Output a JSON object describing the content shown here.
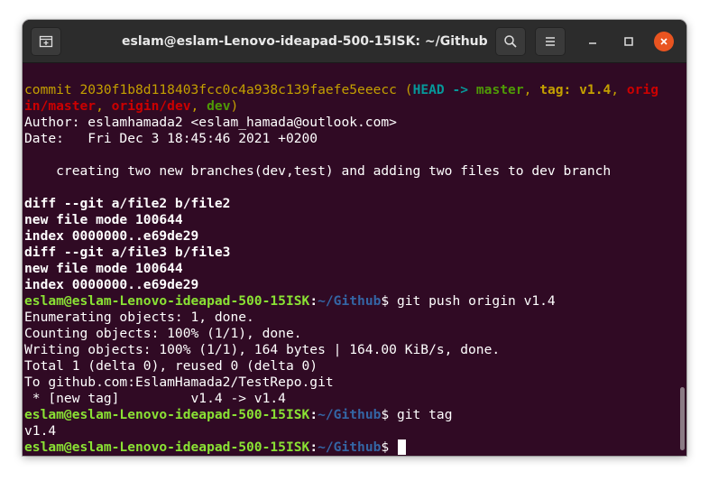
{
  "window": {
    "title": "eslam@eslam-Lenovo-ideapad-500-15ISK: ~/Github",
    "buttons": {
      "new_tab_icon": "new-tab-icon",
      "search_icon": "search-icon",
      "menu_icon": "hamburger-menu-icon",
      "minimize_icon": "minimize-icon",
      "maximize_icon": "maximize-icon",
      "close_icon": "close-icon"
    }
  },
  "colors": {
    "terminal_bg": "#300a24",
    "titlebar_bg": "#2c2c2c",
    "close_accent": "#e95420",
    "prompt_user": "#4e9a06",
    "prompt_path": "#3465a4",
    "commit_yellow": "#c4a000",
    "head_cyan": "#06989a",
    "branch_green": "#4e9a06",
    "remote_red": "#cc0000"
  },
  "terminal": {
    "commit_line1": {
      "commit_word": "commit",
      "hash": "2030f1b8d118403fcc0c4a938c139faefe5eeecc",
      "paren_open": "(",
      "head": "HEAD",
      "arrow": "->",
      "master": "master",
      "comma1": ",",
      "tag": "tag: v1.4",
      "comma2": ",",
      "orig_part": "orig"
    },
    "commit_line2": {
      "in_master": "in/master",
      "comma3": ",",
      "origin_dev": "origin/dev",
      "comma4": ",",
      "dev": "dev",
      "paren_close": ")"
    },
    "author_line": "Author: eslamhamada2 <eslam_hamada@outlook.com>",
    "date_line": "Date:   Fri Dec 3 18:45:46 2021 +0200",
    "message_line": "    creating two new branches(dev,test) and adding two files to dev branch",
    "diff_lines": [
      "diff --git a/file2 b/file2",
      "new file mode 100644",
      "index 0000000..e69de29",
      "diff --git a/file3 b/file3",
      "new file mode 100644",
      "index 0000000..e69de29"
    ],
    "prompt": {
      "user_host": "eslam@eslam-Lenovo-ideapad-500-15ISK",
      "colon": ":",
      "path": "~/Github",
      "dollar": "$"
    },
    "cmd_push": " git push origin v1.4",
    "push_output": [
      "Enumerating objects: 1, done.",
      "Counting objects: 100% (1/1), done.",
      "Writing objects: 100% (1/1), 164 bytes | 164.00 KiB/s, done.",
      "Total 1 (delta 0), reused 0 (delta 0)",
      "To github.com:EslamHamada2/TestRepo.git",
      " * [new tag]         v1.4 -> v1.4"
    ],
    "cmd_tag": " git tag",
    "tag_output": "v1.4",
    "cmd_final": " "
  }
}
